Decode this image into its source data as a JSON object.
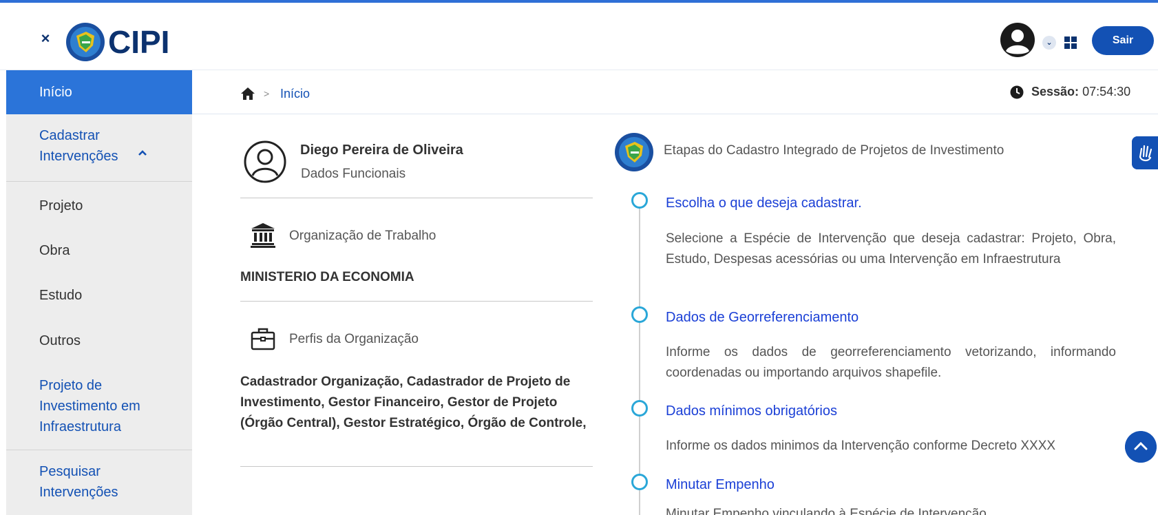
{
  "app": {
    "logo_text": "CIPI",
    "close_label": "×",
    "logout_label": "Sair"
  },
  "sidebar": {
    "items": [
      {
        "label": "Início",
        "state": "active"
      },
      {
        "label": "Cadastrar Intervenções",
        "state": "expanded"
      },
      {
        "label": "Projeto"
      },
      {
        "label": "Obra"
      },
      {
        "label": "Estudo"
      },
      {
        "label": "Outros"
      },
      {
        "label": "Projeto de Investimento em Infraestrutura"
      },
      {
        "label": "Pesquisar Intervenções"
      }
    ]
  },
  "breadcrumb": {
    "separator": ">",
    "current": "Início"
  },
  "session": {
    "label": "Sessão:",
    "time": "07:54:30"
  },
  "profile": {
    "name": "Diego Pereira de Oliveira",
    "subtitle": "Dados Funcionais",
    "org_label": "Organização de Trabalho",
    "org_value": "MINISTERIO DA ECONOMIA",
    "profiles_label": "Perfis da Organização",
    "profiles_value": "Cadastrador Organização, Cadastrador de Projeto de Investimento, Gestor Financeiro, Gestor de Projeto (Órgão Central), Gestor Estratégico, Órgão de Controle,"
  },
  "steps": {
    "title": "Etapas do Cadastro Integrado de Projetos de Investimento",
    "items": [
      {
        "title": "Escolha o que deseja cadastrar.",
        "desc": "Selecione a Espécie de Intervenção que deseja cadastrar: Projeto, Obra, Estudo, Despesas acessórias ou uma Intervenção em Infraestrutura"
      },
      {
        "title": "Dados de Georreferenciamento",
        "desc": "Informe os dados de georreferenciamento vetorizando, informando coordenadas ou importando arquivos shapefile."
      },
      {
        "title": "Dados mínimos obrigatórios",
        "desc": "Informe os dados minimos da Intervenção conforme Decreto XXXX"
      },
      {
        "title": "Minutar Empenho",
        "desc": "Minutar Empenho vinculando à Espécie de Intervenção"
      }
    ]
  },
  "colors": {
    "primary": "#1351b4",
    "sidebar_active": "#2b74d9",
    "sidebar_bg": "#ededed",
    "step_link": "#1a3fd6",
    "step_dot": "#2aa7d8"
  }
}
